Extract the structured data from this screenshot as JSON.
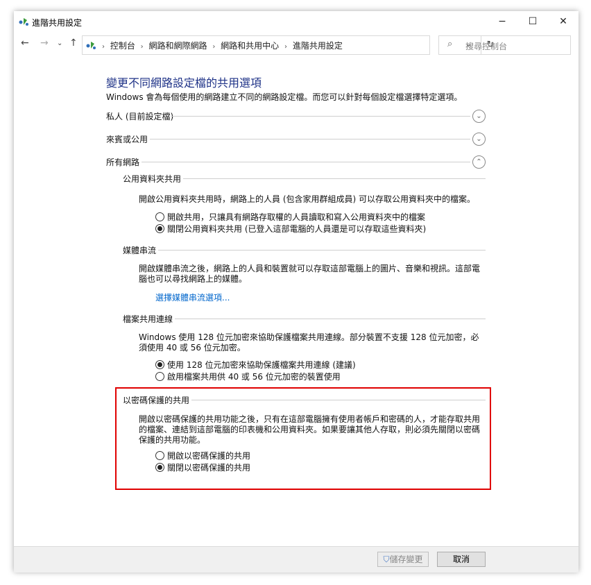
{
  "window": {
    "title": "進階共用設定"
  },
  "address": {
    "crumbs": [
      "控制台",
      "網路和網際網路",
      "網路和共用中心",
      "進階共用設定"
    ],
    "search_placeholder": "搜尋控制台"
  },
  "main": {
    "heading": "變更不同網路設定檔的共用選項",
    "description": "Windows 會為每個使用的網路建立不同的網路設定檔。而您可以針對每個設定檔選擇特定選項。",
    "profiles": {
      "private": "私人 (目前設定檔)",
      "guest": "來賓或公用",
      "all": "所有網路"
    },
    "public_folder": {
      "title": "公用資料夾共用",
      "desc": "開啟公用資料夾共用時，網路上的人員 (包含家用群組成員) 可以存取公用資料夾中的檔案。",
      "option_on": "開啟共用，只讓具有網路存取權的人員讀取和寫入公用資料夾中的檔案",
      "option_off": "關閉公用資料夾共用 (已登入這部電腦的人員還是可以存取這些資料夾)"
    },
    "media": {
      "title": "媒體串流",
      "desc": "開啟媒體串流之後，網路上的人員和裝置就可以存取這部電腦上的圖片、音樂和視訊。這部電腦也可以尋找網路上的媒體。",
      "link": "選擇媒體串流選項..."
    },
    "file_sharing": {
      "title": "檔案共用連線",
      "desc": "Windows 使用 128 位元加密來協助保護檔案共用連線。部分裝置不支援 128 位元加密，必須使用 40 或 56 位元加密。",
      "option_128": "使用 128 位元加密來協助保護檔案共用連線 (建議)",
      "option_40": "啟用檔案共用供 40 或 56 位元加密的裝置使用"
    },
    "password": {
      "title": "以密碼保護的共用",
      "desc": "開啟以密碼保護的共用功能之後，只有在這部電腦擁有使用者帳戶和密碼的人，才能存取共用的檔案、連結到這部電腦的印表機和公用資料夾。如果要讓其他人存取，則必須先關閉以密碼保護的共用功能。",
      "option_on": "開啟以密碼保護的共用",
      "option_off": "關閉以密碼保護的共用"
    }
  },
  "footer": {
    "save": "儲存變更",
    "cancel": "取消"
  },
  "colors": {
    "highlight": "#e00000",
    "heading": "#1e3287",
    "link": "#0066cc"
  }
}
